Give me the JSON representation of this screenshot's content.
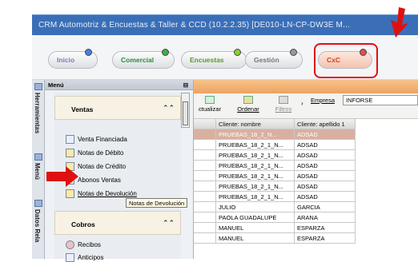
{
  "window": {
    "title": "CRM Automotriz & Encuestas & Taller & CCD (10.2.2.35) [DE010-LN-CP-DW3E M..."
  },
  "modules": [
    {
      "label": "Inicio",
      "color": "#7a7fb0"
    },
    {
      "label": "Comercial",
      "color": "#2a8a3a"
    },
    {
      "label": "Encuestas",
      "color": "#5a9a20"
    },
    {
      "label": "Gestión",
      "color": "#777777"
    },
    {
      "label": "CxC",
      "color": "#d84020"
    }
  ],
  "side_tabs": {
    "herramientas": "Herramientas",
    "menu": "Menú",
    "datos": "Datos Rela"
  },
  "menu": {
    "title": "Menú",
    "pin": "⊟",
    "sections": [
      {
        "label": "Ventas",
        "items": [
          "Venta Financiada",
          "Notas de Débito",
          "Notas de Crédito",
          "Abonos Ventas",
          "Notas de Devolución"
        ]
      },
      {
        "label": "Cobros",
        "items": [
          "Recibos",
          "Anticipos"
        ]
      }
    ],
    "tooltip": "Notas de Devolución"
  },
  "toolbar": {
    "actualizar": "ctualizar",
    "ordenar": "Ordenar",
    "filtros": "Filtros",
    "empresa_label": "Empresa",
    "empresa_value": "INFORSE"
  },
  "grid": {
    "headers": [
      "",
      "Cliente: nombre",
      "Cliente: apellido 1"
    ],
    "rows": [
      {
        "nombre": "PRUEBAS_18_2_N...",
        "apellido": "ADSAD",
        "selected": true
      },
      {
        "nombre": "PRUEBAS_18_2_1_N...",
        "apellido": "ADSAD",
        "selected": false
      },
      {
        "nombre": "PRUEBAS_18_2_1_N...",
        "apellido": "ADSAD",
        "selected": false
      },
      {
        "nombre": "PRUEBAS_18_2_1_N...",
        "apellido": "ADSAD",
        "selected": false
      },
      {
        "nombre": "PRUEBAS_18_2_1_N...",
        "apellido": "ADSAD",
        "selected": false
      },
      {
        "nombre": "PRUEBAS_18_2_1_N...",
        "apellido": "ADSAD",
        "selected": false
      },
      {
        "nombre": "PRUEBAS_18_2_1_N...",
        "apellido": "ADSAD",
        "selected": false
      },
      {
        "nombre": "JULIO",
        "apellido": "GARCIA",
        "selected": false
      },
      {
        "nombre": "PAOLA GUADALUPE",
        "apellido": "ARANA",
        "selected": false
      },
      {
        "nombre": "MANUEL",
        "apellido": "ESPARZA",
        "selected": false
      },
      {
        "nombre": "MANUEL",
        "apellido": "ESPARZA",
        "selected": false
      }
    ]
  },
  "annotations": {
    "arrow_color": "#e01010"
  }
}
